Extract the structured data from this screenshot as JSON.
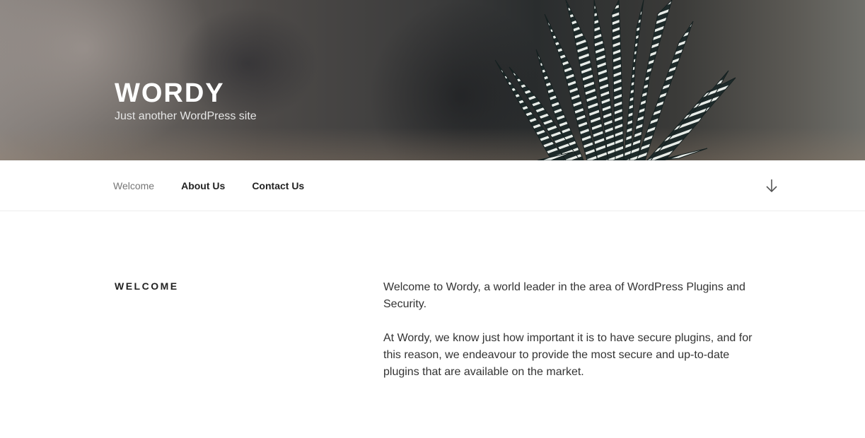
{
  "site": {
    "title": "WORDY",
    "description": "Just another WordPress site"
  },
  "nav": {
    "items": [
      {
        "label": "Welcome",
        "current": true
      },
      {
        "label": "About Us",
        "current": false
      },
      {
        "label": "Contact Us",
        "current": false
      }
    ],
    "scroll_icon": "arrow-down-icon"
  },
  "page": {
    "title": "WELCOME",
    "paragraphs": [
      "Welcome to Wordy, a world leader in the area of WordPress Plugins and Security.",
      "At Wordy, we know just how important it is to have secure plugins, and for this reason, we endeavour to provide the most secure and up-to-date plugins that are available on the market."
    ]
  },
  "colors": {
    "text": "#222222",
    "nav_current": "#767676"
  }
}
